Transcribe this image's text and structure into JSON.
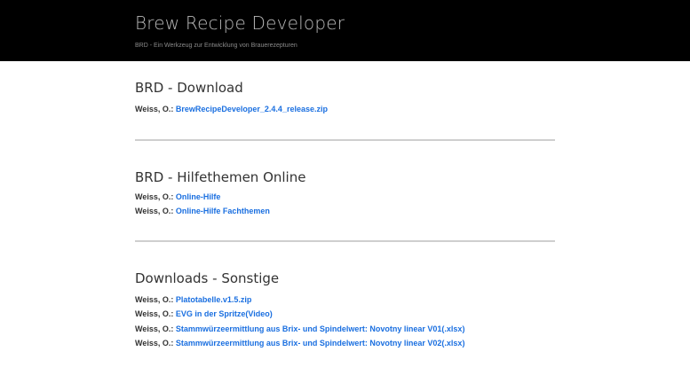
{
  "header": {
    "title": "Brew Recipe Developer",
    "subtitle": "BRD - Ein Werkzeug zur Entwicklung von Brauerezepturen"
  },
  "sections": [
    {
      "title": "BRD - Download",
      "entries": [
        {
          "author": "Weiss, O.:",
          "link": "BrewRecipeDeveloper_2.4.4_release.zip"
        }
      ]
    },
    {
      "title": "BRD - Hilfethemen Online",
      "entries": [
        {
          "author": "Weiss, O.:",
          "link": "Online-Hilfe"
        },
        {
          "author": "Weiss, O.:",
          "link": "Online-Hilfe Fachthemen"
        }
      ]
    },
    {
      "title": "Downloads - Sonstige",
      "entries": [
        {
          "author": "Weiss, O.:",
          "link": "Platotabelle.v1.5.zip"
        },
        {
          "author": "Weiss, O.:",
          "link": "EVG in der Spritze(Video)"
        },
        {
          "author": "Weiss, O.:",
          "link": "Stammwürzeermittlung aus Brix- und Spindelwert: Novotny linear V01(.xlsx)"
        },
        {
          "author": "Weiss, O.:",
          "link": "Stammwürzeermittlung aus Brix- und Spindelwert: Novotny linear V02(.xlsx)"
        }
      ]
    }
  ],
  "colors": {
    "header_bg": "#000000",
    "link": "#1a6fe0",
    "divider": "#cfcfcf"
  }
}
